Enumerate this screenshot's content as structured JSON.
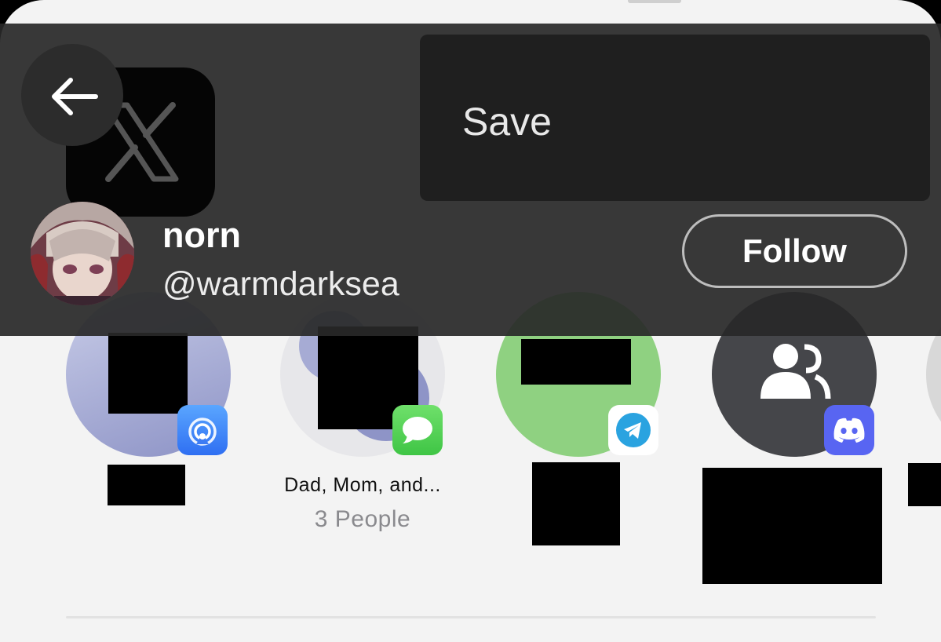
{
  "menu": {
    "items": [
      {
        "label": "Save"
      }
    ]
  },
  "profile": {
    "name": "norn",
    "handle": "@warmdarksea",
    "follow_label": "Follow"
  },
  "share_targets": [
    {
      "app": "airdrop",
      "label": "",
      "sub": ""
    },
    {
      "app": "messages",
      "label": "Dad, Mom, and...",
      "sub": "3 People"
    },
    {
      "app": "telegram",
      "label": "",
      "sub": ""
    },
    {
      "app": "discord",
      "label": "",
      "sub": ""
    }
  ],
  "icons": {
    "back": "arrow-left-icon",
    "logo": "x-logo",
    "group": "people-icon"
  },
  "colors": {
    "overlay": "#282828",
    "menu_bg": "#1f1f1f",
    "discord": "#5865f2",
    "telegram": "#2aa3e0",
    "messages": "#3fc545",
    "airdrop": "#2f6ff2"
  }
}
